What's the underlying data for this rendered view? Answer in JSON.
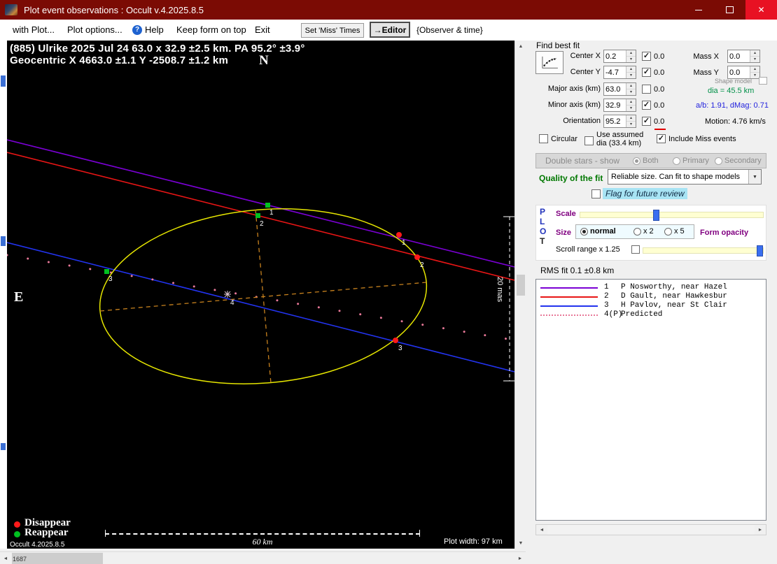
{
  "window": {
    "title": "Plot event observations : Occult v.4.2025.8.5"
  },
  "menu": {
    "with_plot": "with Plot...",
    "plot_options": "Plot options...",
    "help": "Help",
    "keep_on_top": "Keep form on top",
    "exit": "Exit",
    "set_miss_times": "Set 'Miss' Times",
    "editor": "→Editor",
    "observer_time": "{Observer & time}"
  },
  "plot": {
    "title_line1": "(885) Ulrike  2025 Jul 24   63.0 x 32.9 ±2.5 km.  PA 95.2° ±3.9°",
    "title_line2": "Geocentric  X  4663.0 ±1.1  Y  -2508.7 ±1.2 km",
    "north": "N",
    "east": "E",
    "mas_label": "20 mas",
    "legend_disappear": "Disappear",
    "legend_reappear": "Reappear",
    "version": "Occult 4.2025.8.5",
    "scale_label": "60 km",
    "plot_width": "Plot width: 97 km",
    "markers": [
      {
        "label": "1",
        "color": "green"
      },
      {
        "label": "2",
        "color": "green"
      },
      {
        "label": "3",
        "color": "green"
      },
      {
        "label": "1",
        "color": "red"
      },
      {
        "label": "2",
        "color": "red"
      },
      {
        "label": "3",
        "color": "red"
      },
      {
        "label": "4",
        "color": "asterisk"
      }
    ],
    "colors": {
      "ellipse": "#e6e600",
      "axes": "#c8821e",
      "chord1": "#7a00d4",
      "chord2": "#e81515",
      "chord3": "#2233ee",
      "predicted": "#e87898",
      "disappear": "#ff1a1a",
      "reappear": "#00c020"
    }
  },
  "fit": {
    "find_best_fit": "Find best fit",
    "center_x": {
      "label": "Center X",
      "value": "0.2",
      "check": "✓",
      "locked": "0.0"
    },
    "center_y": {
      "label": "Center Y",
      "value": "-4.7",
      "check": "✓",
      "locked": "0.0"
    },
    "major_axis": {
      "label": "Major axis (km)",
      "value": "63.0",
      "check": "",
      "locked": "0.0"
    },
    "minor_axis": {
      "label": "Minor axis (km)",
      "value": "32.9",
      "check": "✓",
      "locked": "0.0"
    },
    "orientation": {
      "label": "Orientation",
      "value": "95.2",
      "check": "✓",
      "locked": "0.0"
    },
    "mass_x": {
      "label": "Mass X",
      "value": "0.0"
    },
    "mass_y": {
      "label": "Mass Y",
      "value": "0.0"
    },
    "shape_model": "Shape model",
    "dia": "dia = 45.5 km",
    "ab": "a/b: 1.91, dMag: 0.71",
    "motion": "Motion: 4.76 km/s",
    "circular": {
      "label": "Circular",
      "check": ""
    },
    "use_assumed": {
      "line1": "Use assumed",
      "line2": "dia (33.4 km)",
      "check": ""
    },
    "include_miss": {
      "label": "Include Miss events",
      "check": "✓"
    }
  },
  "double_stars": {
    "label": "Double stars - show",
    "both": "Both",
    "primary": "Primary",
    "secondary": "Secondary",
    "selected": "Both"
  },
  "quality": {
    "label": "Quality of the fit",
    "value": "Reliable size. Can fit to shape models"
  },
  "flag_review": {
    "label": "Flag for future review",
    "check": ""
  },
  "plot_controls": {
    "p": "P",
    "l": "L",
    "o": "O",
    "t": "T",
    "scale": "Scale",
    "size": "Size",
    "normal": "normal",
    "x2": "x 2",
    "x5": "x 5",
    "size_selected": "normal",
    "form_opacity": "Form opacity",
    "scroll_range": "Scroll range x 1.25",
    "scroll_check": ""
  },
  "rms": "RMS fit 0.1 ±0.8 km",
  "observations": [
    {
      "num": "1",
      "name": "P Nosworthy, near Hazel",
      "color": "#7a00d4",
      "line": "solid"
    },
    {
      "num": "2",
      "name": "D Gault, near Hawkesbur",
      "color": "#e81515",
      "line": "solid"
    },
    {
      "num": "3",
      "name": "H Pavlov, near St Clair",
      "color": "#2233ee",
      "line": "solid"
    },
    {
      "num": "4(P)",
      "name": "Predicted",
      "color": "#e87898",
      "line": "dotted"
    }
  ],
  "statusbar": {
    "left": "1687"
  }
}
